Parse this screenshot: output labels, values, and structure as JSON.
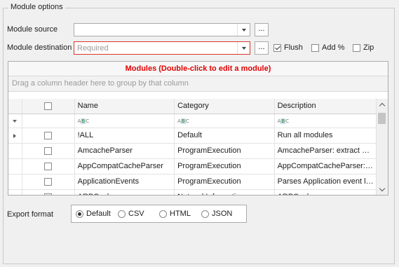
{
  "group_title": "Module options",
  "module_source": {
    "label": "Module source",
    "value": "",
    "button": "..."
  },
  "module_destination": {
    "label": "Module destination",
    "placeholder": "Required",
    "button": "..."
  },
  "flush": {
    "label": "Flush",
    "checked": true
  },
  "add_percent": {
    "label": "Add %",
    "checked": false
  },
  "zip": {
    "label": "Zip",
    "checked": false
  },
  "grid": {
    "caption": "Modules (Double-click to edit a module)",
    "group_panel_text": "Drag a column header here to group by that column",
    "columns": [
      "Name",
      "Category",
      "Description"
    ],
    "filter_icon": "abc-filter-icon",
    "rows": [
      {
        "name": "!ALL",
        "category": "Default",
        "description": "Run all modules"
      },
      {
        "name": "AmcacheParser",
        "category": "ProgramExecution",
        "description": "AmcacheParser: extract programs"
      },
      {
        "name": "AppCompatCacheParser",
        "category": "ProgramExecution",
        "description": "AppCompatCacheParser: extract"
      },
      {
        "name": "ApplicationEvents",
        "category": "ProgramExecution",
        "description": "Parses Application event logs"
      },
      {
        "name": "ARPCache",
        "category": "NetworkInformation",
        "description": "ARPCache"
      }
    ]
  },
  "export": {
    "label": "Export format",
    "options": [
      "Default",
      "CSV",
      "HTML",
      "JSON"
    ],
    "selected": "Default"
  }
}
